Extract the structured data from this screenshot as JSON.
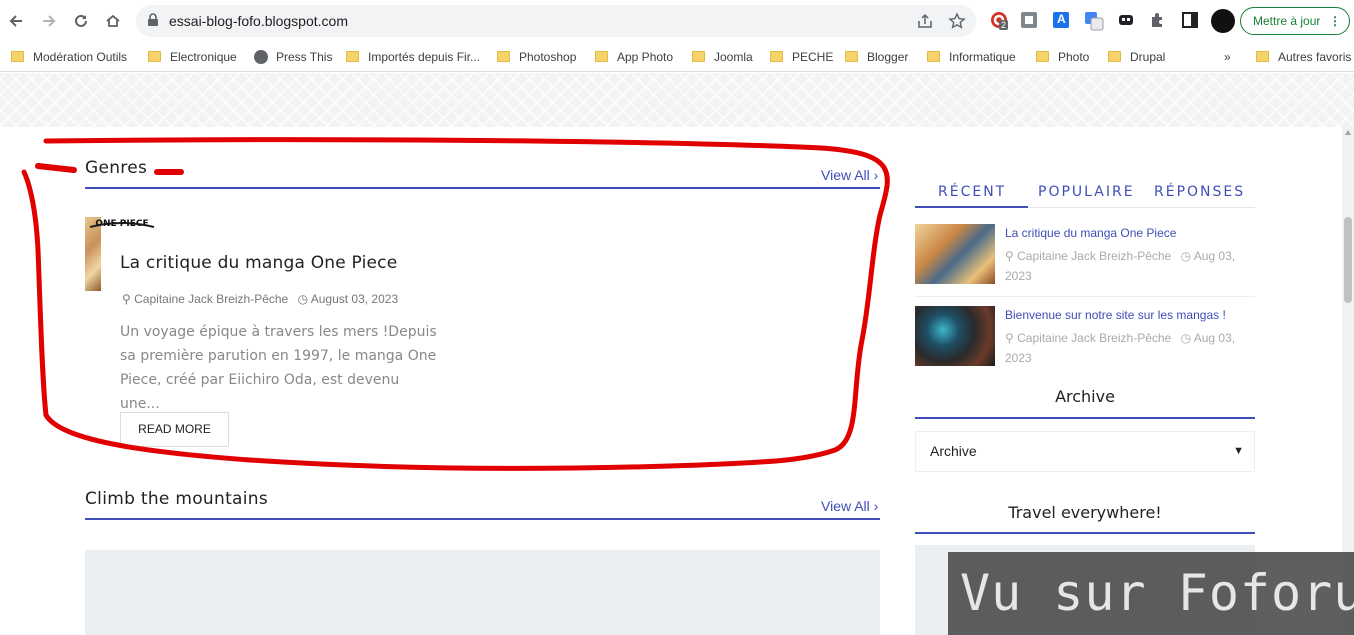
{
  "browser": {
    "url": "essai-blog-fofo.blogspot.com",
    "update_label": "Mettre à jour",
    "update_menu": "⋮",
    "extension_badge": "2",
    "translate_label": "A"
  },
  "bookmarks": [
    {
      "label": "Modération Outils",
      "icon": "folder-icon"
    },
    {
      "label": "Electronique",
      "icon": "folder-icon"
    },
    {
      "label": "Press This",
      "icon": "globe-icon"
    },
    {
      "label": "Importés depuis Fir...",
      "icon": "folder-icon"
    },
    {
      "label": "Photoshop",
      "icon": "folder-icon"
    },
    {
      "label": "App Photo",
      "icon": "folder-icon"
    },
    {
      "label": "Joomla",
      "icon": "folder-icon"
    },
    {
      "label": "PECHE",
      "icon": "folder-icon"
    },
    {
      "label": "Blogger",
      "icon": "folder-icon"
    },
    {
      "label": "Informatique",
      "icon": "folder-icon"
    },
    {
      "label": "Photo",
      "icon": "folder-icon"
    },
    {
      "label": "Drupal",
      "icon": "folder-icon"
    }
  ],
  "bookmarks_more": "»",
  "bookmarks_other": "Autres favoris",
  "sections": {
    "genres": {
      "title": "Genres",
      "view_all": "View All",
      "post": {
        "thumb_text": "ONE PIECE",
        "title": "La critique du manga One Piece",
        "author": "Capitaine Jack Breizh-Pêche",
        "date": "August 03, 2023",
        "excerpt": " Un voyage épique à travers les mers !Depuis sa première parution en 1997, le manga One Piece, créé par Eiichiro Oda, est devenu une...",
        "read_more": "READ MORE"
      }
    },
    "climb": {
      "title": "Climb the mountains",
      "view_all": "View All"
    }
  },
  "sidebar": {
    "tabs": [
      "RÉCENT",
      "POPULAIRE",
      "RÉPONSES"
    ],
    "posts": [
      {
        "title": "La critique du manga One Piece",
        "author": "Capitaine Jack Breizh-Pêche",
        "date": "Aug 03, 2023"
      },
      {
        "title": "Bienvenue sur notre site sur les mangas !",
        "author": "Capitaine Jack Breizh-Pêche",
        "date": "Aug 03, 2023"
      }
    ],
    "archive_title": "Archive",
    "archive_select": "Archive",
    "travel_title": "Travel everywhere!"
  },
  "watermark": "Vu sur Foforum",
  "colors": {
    "accent": "#3f4eb8",
    "annotation": "#e00000",
    "update": "#188038"
  }
}
